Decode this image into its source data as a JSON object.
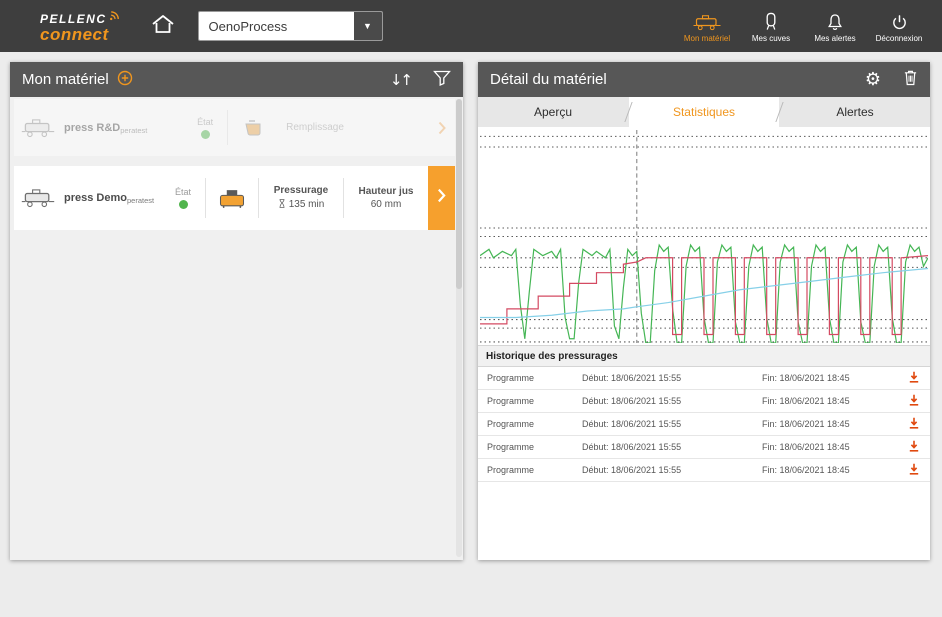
{
  "colors": {
    "accent": "#f0961e",
    "topbar_bg": "#3e3e3e",
    "panel_header_bg": "#575757",
    "status_green": "#51b54d",
    "download_icon": "#e0490f"
  },
  "topbar": {
    "logo_line1": "PELLENC",
    "logo_line2": "connect",
    "process_selected": "OenoProcess",
    "nav": [
      {
        "label": "Mon matériel",
        "icon": "press-icon",
        "active": true
      },
      {
        "label": "Mes cuves",
        "icon": "tank-icon",
        "active": false
      },
      {
        "label": "Mes alertes",
        "icon": "bell-icon",
        "active": false
      },
      {
        "label": "Déconnexion",
        "icon": "power-icon",
        "active": false
      }
    ]
  },
  "left_panel": {
    "title": "Mon matériel",
    "rows": [
      {
        "name": "press R&D",
        "name_suffix": "peratest",
        "etat_label": "État",
        "status": "green",
        "mode_label": "Remplissage",
        "disabled": true
      },
      {
        "name": "press Demo",
        "name_suffix": "peratest",
        "etat_label": "État",
        "status": "green",
        "mode_label": "Pressurage",
        "duration": "135 min",
        "metric_label": "Hauteur jus",
        "metric_value": "60 mm",
        "disabled": false
      }
    ]
  },
  "right_panel": {
    "title": "Détail du matériel",
    "tabs": [
      {
        "label": "Aperçu",
        "active": false
      },
      {
        "label": "Statistiques",
        "active": true
      },
      {
        "label": "Alertes",
        "active": false
      }
    ],
    "history": {
      "title": "Historique des pressurages",
      "rows": [
        {
          "program": "Programme",
          "start": "Début: 18/06/2021 15:55",
          "end": "Fin: 18/06/2021 18:45"
        },
        {
          "program": "Programme",
          "start": "Début: 18/06/2021 15:55",
          "end": "Fin: 18/06/2021 18:45"
        },
        {
          "program": "Programme",
          "start": "Début: 18/06/2021 15:55",
          "end": "Fin: 18/06/2021 18:45"
        },
        {
          "program": "Programme",
          "start": "Début: 18/06/2021 15:55",
          "end": "Fin: 18/06/2021 18:45"
        },
        {
          "program": "Programme",
          "start": "Début: 18/06/2021 15:55",
          "end": "Fin: 18/06/2021 18:45"
        }
      ]
    }
  },
  "chart_data": {
    "type": "line",
    "title": "",
    "xlabel": "",
    "ylabel": "",
    "xlim": [
      0,
      100
    ],
    "ylim": [
      0,
      100
    ],
    "axes_labels_visible": false,
    "legend": "none",
    "grid": "horizontal dotted threshold lines",
    "dotted_lines_y": [
      97,
      92,
      54,
      50,
      40,
      35.5,
      11,
      7,
      0.5
    ],
    "vline_x": 35,
    "series": [
      {
        "name": "green",
        "color": "#45b655",
        "points": [
          [
            0,
            41
          ],
          [
            2,
            44
          ],
          [
            3,
            40
          ],
          [
            5,
            43
          ],
          [
            7,
            41
          ],
          [
            8,
            44
          ],
          [
            9,
            18
          ],
          [
            10,
            2
          ],
          [
            11,
            24
          ],
          [
            12,
            44
          ],
          [
            14,
            41
          ],
          [
            16,
            43
          ],
          [
            17,
            40
          ],
          [
            18,
            44
          ],
          [
            19,
            12
          ],
          [
            20,
            2
          ],
          [
            21,
            2
          ],
          [
            22,
            28
          ],
          [
            23,
            44
          ],
          [
            25,
            41
          ],
          [
            26,
            43
          ],
          [
            28,
            40
          ],
          [
            29,
            44
          ],
          [
            30,
            8
          ],
          [
            31,
            2
          ],
          [
            32,
            26
          ],
          [
            33,
            44
          ],
          [
            34,
            41
          ],
          [
            35,
            43
          ],
          [
            36,
            14
          ],
          [
            37,
            0
          ],
          [
            38,
            0
          ],
          [
            39,
            34
          ],
          [
            40,
            46
          ],
          [
            41,
            43
          ],
          [
            42,
            45
          ],
          [
            43,
            16
          ],
          [
            44,
            0
          ],
          [
            45,
            0
          ],
          [
            46,
            36
          ],
          [
            47,
            46
          ],
          [
            48,
            43
          ],
          [
            49,
            45
          ],
          [
            50,
            12
          ],
          [
            51,
            0
          ],
          [
            52,
            0
          ],
          [
            53,
            38
          ],
          [
            54,
            46
          ],
          [
            55,
            43
          ],
          [
            56,
            45
          ],
          [
            57,
            10
          ],
          [
            58,
            0
          ],
          [
            59,
            0
          ],
          [
            60,
            36
          ],
          [
            61,
            46
          ],
          [
            62,
            43
          ],
          [
            63,
            45
          ],
          [
            64,
            12
          ],
          [
            65,
            0
          ],
          [
            66,
            0
          ],
          [
            67,
            38
          ],
          [
            68,
            46
          ],
          [
            69,
            43
          ],
          [
            70,
            45
          ],
          [
            71,
            10
          ],
          [
            72,
            0
          ],
          [
            73,
            0
          ],
          [
            74,
            36
          ],
          [
            75,
            46
          ],
          [
            76,
            43
          ],
          [
            77,
            45
          ],
          [
            78,
            12
          ],
          [
            79,
            0
          ],
          [
            80,
            0
          ],
          [
            81,
            38
          ],
          [
            82,
            46
          ],
          [
            83,
            43
          ],
          [
            84,
            45
          ],
          [
            85,
            10
          ],
          [
            86,
            0
          ],
          [
            87,
            0
          ],
          [
            88,
            36
          ],
          [
            89,
            46
          ],
          [
            90,
            43
          ],
          [
            91,
            45
          ],
          [
            92,
            12
          ],
          [
            93,
            0
          ],
          [
            94,
            0
          ],
          [
            95,
            38
          ],
          [
            96,
            46
          ],
          [
            97,
            43
          ],
          [
            98,
            45
          ],
          [
            99,
            36
          ],
          [
            100,
            40
          ]
        ]
      },
      {
        "name": "red",
        "color": "#d44a62",
        "points": [
          [
            0,
            9
          ],
          [
            6,
            9
          ],
          [
            6,
            16
          ],
          [
            13,
            16
          ],
          [
            13,
            22
          ],
          [
            20,
            22
          ],
          [
            20,
            28
          ],
          [
            26,
            28
          ],
          [
            26,
            33
          ],
          [
            32,
            33
          ],
          [
            32,
            37
          ],
          [
            35,
            38
          ],
          [
            37,
            40
          ],
          [
            43,
            40
          ],
          [
            43,
            4
          ],
          [
            45,
            4
          ],
          [
            45,
            40
          ],
          [
            50,
            40
          ],
          [
            50,
            4
          ],
          [
            52,
            4
          ],
          [
            52,
            40
          ],
          [
            57,
            40
          ],
          [
            57,
            4
          ],
          [
            59,
            4
          ],
          [
            59,
            40
          ],
          [
            64,
            40
          ],
          [
            64,
            4
          ],
          [
            66,
            4
          ],
          [
            66,
            40
          ],
          [
            71,
            40
          ],
          [
            71,
            4
          ],
          [
            73,
            4
          ],
          [
            73,
            40
          ],
          [
            78,
            40
          ],
          [
            78,
            4
          ],
          [
            80,
            4
          ],
          [
            80,
            40
          ],
          [
            85,
            40
          ],
          [
            85,
            4
          ],
          [
            87,
            4
          ],
          [
            87,
            40
          ],
          [
            92,
            40
          ],
          [
            92,
            4
          ],
          [
            94,
            4
          ],
          [
            94,
            40
          ],
          [
            100,
            41
          ]
        ]
      },
      {
        "name": "blue",
        "color": "#86d0e8",
        "points": [
          [
            0,
            12
          ],
          [
            8,
            12
          ],
          [
            16,
            13
          ],
          [
            24,
            15
          ],
          [
            32,
            16
          ],
          [
            35,
            17
          ],
          [
            42,
            19
          ],
          [
            50,
            22
          ],
          [
            58,
            25
          ],
          [
            66,
            27
          ],
          [
            74,
            29
          ],
          [
            82,
            31
          ],
          [
            90,
            33
          ],
          [
            100,
            35
          ]
        ]
      }
    ]
  }
}
